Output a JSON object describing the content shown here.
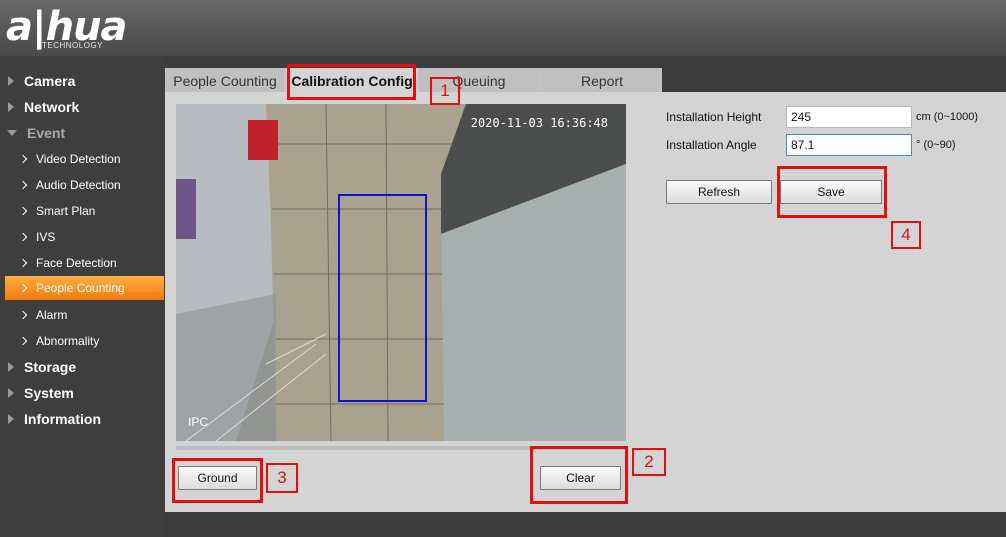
{
  "header": {
    "logo_text": "a|hua",
    "logo_sub": "TECHNOLOGY"
  },
  "sidebar": {
    "items": [
      {
        "label": "Camera",
        "level": 1,
        "state": "collapsed"
      },
      {
        "label": "Network",
        "level": 1,
        "state": "collapsed"
      },
      {
        "label": "Event",
        "level": 1,
        "state": "expanded"
      },
      {
        "label": "Video Detection",
        "level": 2
      },
      {
        "label": "Audio Detection",
        "level": 2
      },
      {
        "label": "Smart Plan",
        "level": 2
      },
      {
        "label": "IVS",
        "level": 2
      },
      {
        "label": "Face Detection",
        "level": 2
      },
      {
        "label": "People Counting",
        "level": 2,
        "active": true
      },
      {
        "label": "Alarm",
        "level": 2
      },
      {
        "label": "Abnormality",
        "level": 2
      },
      {
        "label": "Storage",
        "level": 1,
        "state": "collapsed"
      },
      {
        "label": "System",
        "level": 1,
        "state": "collapsed"
      },
      {
        "label": "Information",
        "level": 1,
        "state": "collapsed"
      }
    ]
  },
  "tabs": [
    {
      "label": "People Counting",
      "active": false
    },
    {
      "label": "Calibration Config",
      "active": true
    },
    {
      "label": "Queuing",
      "active": false
    },
    {
      "label": "Report",
      "active": false
    }
  ],
  "video": {
    "timestamp": "2020-11-03 16:36:48",
    "channel_label": "IPC"
  },
  "form": {
    "height_label": "Installation Height",
    "height_value": "245",
    "height_unit": "cm (0~1000)",
    "angle_label": "Installation Angle",
    "angle_value": "87.1",
    "angle_unit": "° (0~90)"
  },
  "buttons": {
    "refresh": "Refresh",
    "save": "Save",
    "ground": "Ground",
    "clear": "Clear"
  },
  "annotations": [
    "1",
    "2",
    "3",
    "4"
  ],
  "colors": {
    "accent": "#f58a1f",
    "annotation": "#e01010",
    "calibration_box": "#1010d0"
  }
}
